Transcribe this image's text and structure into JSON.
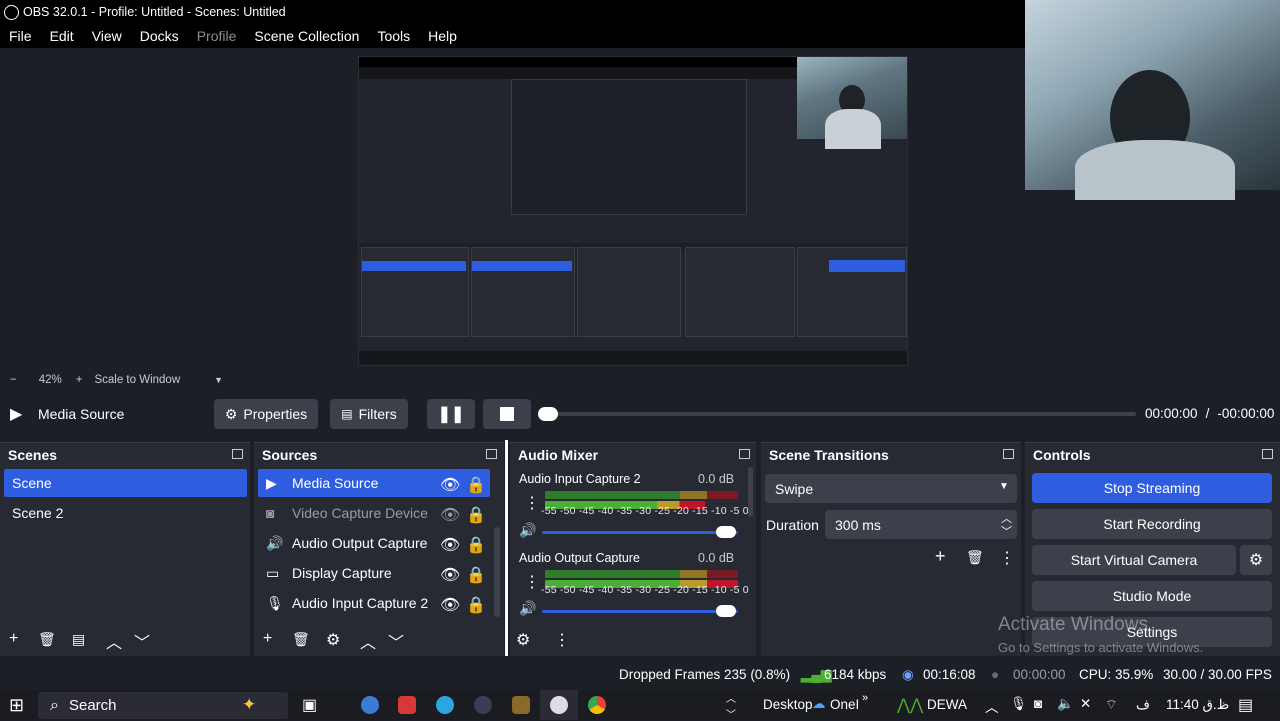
{
  "window": {
    "title": "OBS 32.0.1 - Profile: Untitled - Scenes: Untitled"
  },
  "menu": [
    "File",
    "Edit",
    "View",
    "Docks",
    "Profile",
    "Scene Collection",
    "Tools",
    "Help"
  ],
  "zoom": {
    "minus": "−",
    "value": "42%",
    "plus": "+",
    "mode": "Scale to Window"
  },
  "media": {
    "source_name": "Media Source",
    "properties_label": "Properties",
    "filters_label": "Filters",
    "time_current": "00:00:00",
    "time_sep": "/",
    "time_remaining": "-00:00:00"
  },
  "scenes": {
    "title": "Scenes",
    "items": [
      "Scene",
      "Scene 2"
    ],
    "selected": 0
  },
  "sources": {
    "title": "Sources",
    "items": [
      {
        "label": "Media Source",
        "icon": "play-icon",
        "visible": true
      },
      {
        "label": "Video Capture Device",
        "icon": "camera-icon",
        "visible": false
      },
      {
        "label": "Audio Output Capture",
        "icon": "speaker-icon",
        "visible": true
      },
      {
        "label": "Display Capture",
        "icon": "monitor-icon",
        "visible": true
      },
      {
        "label": "Audio Input Capture 2",
        "icon": "microphone-icon",
        "visible": true
      }
    ]
  },
  "mixer": {
    "title": "Audio Mixer",
    "scale": "-55 -50 -45 -40 -35 -30 -25 -20 -15 -10 -5 0",
    "channels": [
      {
        "name": "Audio Input Capture 2",
        "db": "0.0 dB",
        "volume": 1.0
      },
      {
        "name": "Audio Output Capture",
        "db": "0.0 dB",
        "volume": 1.0
      }
    ]
  },
  "transitions": {
    "title": "Scene Transitions",
    "selected": "Swipe",
    "duration_label": "Duration",
    "duration_value": "300 ms"
  },
  "controls": {
    "title": "Controls",
    "stop_streaming": "Stop Streaming",
    "start_recording": "Start Recording",
    "start_virtual_camera": "Start Virtual Camera",
    "studio_mode": "Studio Mode",
    "settings": "Settings"
  },
  "watermark": {
    "line1": "Activate Windows",
    "line2": "Go to Settings to activate Windows."
  },
  "status": {
    "dropped_frames": "Dropped Frames 235 (0.8%)",
    "bitrate": "6184 kbps",
    "stream_time": "00:16:08",
    "record_time": "00:00:00",
    "cpu": "CPU: 35.9%",
    "fps": "30.00 / 30.00 FPS"
  },
  "taskbar": {
    "search_placeholder": "Search",
    "desktop_label": "Desktop",
    "onedrive_label": "OneI",
    "network_label": "DEWA",
    "time": "11:40 ظ.ق",
    "lang": "ف"
  },
  "colors": {
    "accent": "#2f5de0",
    "panel": "#272a33",
    "background": "#1d1f26",
    "button": "#3c404b"
  }
}
